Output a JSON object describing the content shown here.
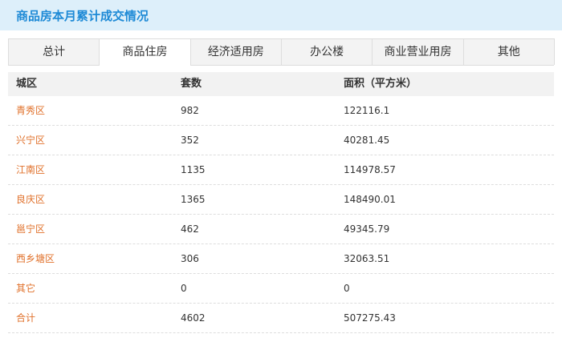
{
  "title": "商品房本月累计成交情况",
  "tabs": [
    "总计",
    "商品住房",
    "经济适用房",
    "办公楼",
    "商业营业用房",
    "其他"
  ],
  "active_tab": 1,
  "columns": [
    "城区",
    "套数",
    "面积（平方米）"
  ],
  "rows": [
    [
      "青秀区",
      "982",
      "122116.1"
    ],
    [
      "兴宁区",
      "352",
      "40281.45"
    ],
    [
      "江南区",
      "1135",
      "114978.57"
    ],
    [
      "良庆区",
      "1365",
      "148490.01"
    ],
    [
      "邕宁区",
      "462",
      "49345.79"
    ],
    [
      "西乡塘区",
      "306",
      "32063.51"
    ],
    [
      "其它",
      "0",
      "0"
    ],
    [
      "合计",
      "4602",
      "507275.43"
    ]
  ]
}
